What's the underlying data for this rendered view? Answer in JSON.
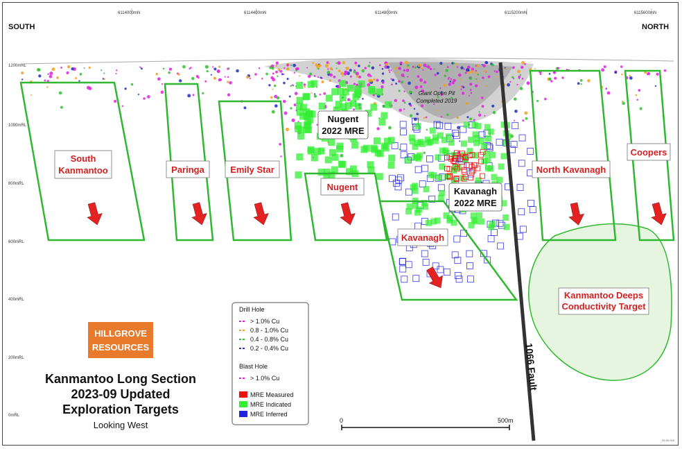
{
  "map": {
    "easting_labels": [
      "6114000mN",
      "6114400mN",
      "6114800mN",
      "6115200mN",
      "6115600mN"
    ],
    "rl_labels": [
      "1200mRL",
      "1000mRL",
      "800mRL",
      "600mRL",
      "400mRL",
      "200mRL",
      "0mRL"
    ],
    "direction_left": "SOUTH",
    "direction_right": "NORTH",
    "targets": [
      {
        "lines": [
          "South",
          "Kanmantoo"
        ]
      },
      {
        "lines": [
          "Paringa"
        ]
      },
      {
        "lines": [
          "Emily Star"
        ]
      },
      {
        "lines": [
          "Nugent"
        ]
      },
      {
        "lines": [
          "Kavanagh"
        ]
      },
      {
        "lines": [
          "North Kavanagh"
        ]
      },
      {
        "lines": [
          "Coopers"
        ]
      }
    ],
    "deeps_target": [
      "Kanmantoo Deeps",
      "Conductivity Target"
    ],
    "mre_labels": [
      {
        "lines": [
          "Nugent",
          "2022 MRE"
        ]
      },
      {
        "lines": [
          "Kavanagh",
          "2022 MRE"
        ]
      }
    ],
    "pit_label": [
      "Giant Open Pit",
      "Completed 2019"
    ],
    "fault_label": "1066 Fault",
    "scale": {
      "start": "0",
      "end": "500m"
    },
    "colors": {
      "target_outline": "#2fb82f",
      "arrow": "#e52222",
      "fault": "#333333",
      "target_label": "#d42020",
      "deeps_fill": "#e6f5e0",
      "logo_bg": "#e87a2c"
    },
    "figure_code": "23-09-010"
  },
  "legend": {
    "drill_title": "Drill Hole",
    "drill_items": [
      {
        "label": "> 1.0% Cu",
        "color": "#e020e0"
      },
      {
        "label": "0.8 - 1.0% Cu",
        "color": "#f0a020"
      },
      {
        "label": "0.4 - 0.8% Cu",
        "color": "#30c030"
      },
      {
        "label": "0.2 - 0.4% Cu",
        "color": "#2030c0"
      }
    ],
    "blast_title": "Blast Hole",
    "blast_items": [
      {
        "label": "> 1.0% Cu",
        "color": "#e020e0"
      }
    ],
    "mre_items": [
      {
        "label": "MRE Measured",
        "color": "#ee1111"
      },
      {
        "label": "MRE Indicated",
        "color": "#33ee33"
      },
      {
        "label": "MRE Inferred",
        "color": "#2222dd"
      }
    ]
  },
  "logo": {
    "line1": "HILLGROVE",
    "line2": "RESOURCES"
  },
  "title": {
    "lines": [
      "Kanmantoo Long Section",
      "2023-09 Updated",
      "Exploration Targets"
    ],
    "subtitle": "Looking West"
  }
}
